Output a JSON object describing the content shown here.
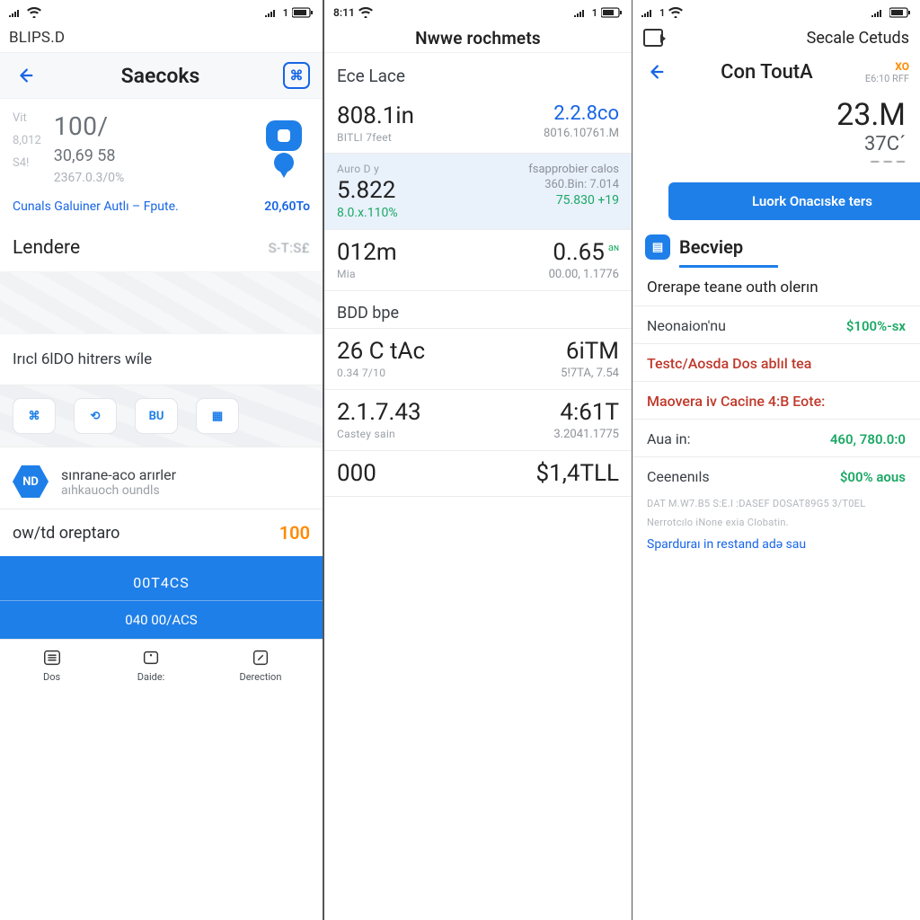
{
  "phone1": {
    "status": {
      "carrier": "BLIPS.D",
      "time": ""
    },
    "header": {
      "title": "Saecoks",
      "icon_glyph": "⌘"
    },
    "metrics": {
      "labels": [
        "Vit",
        "8,012",
        "S4!"
      ],
      "big": "100/",
      "mid": "30,69 58",
      "sm": "2367.0.3/0%"
    },
    "linkrow": {
      "left": "Cunals  Galuiner Autlı – Fpute.",
      "right": "20,60To"
    },
    "section": {
      "title": "Lendere",
      "right": "S-T:S£"
    },
    "rowtitle": "Irıcl 6lDO hitrers wíle",
    "chips": [
      "⌘",
      "⟲",
      "BU",
      "▦"
    ],
    "listcard": {
      "hex": "ND",
      "title": "sınrane-aco arırler",
      "subtitle": "aıhkauoch oundls"
    },
    "rowkv": {
      "k": "ow/td oreptaro",
      "v": "100"
    },
    "bluefoot": {
      "a": "00T4CS",
      "b": "040 00/ACS"
    },
    "tabs": [
      "Dos",
      "Daide:",
      "Derection"
    ]
  },
  "phone2": {
    "status_time": "8:11",
    "title": "Nwwe rochmets",
    "section": "Ece Lace",
    "rows": [
      {
        "la": "808.1in",
        "lb": "BITLI 7feet",
        "ra": "2.2.8co",
        "rb": "8016.10761.M",
        "raClass": "c"
      },
      {
        "hl": true,
        "la": "Auro D y",
        "lb": "",
        "la2": "5.822",
        "lc": "8.0.x.110%",
        "ra": "",
        "re": "fsapprobier calos",
        "rb": "360.Bin:   7.014",
        "rc": "75.830 +19"
      },
      {
        "la": "012m",
        "lb": "Mia",
        "ra": "0..65",
        "rb": "00.00, 1.1776",
        "riny": "aɴ"
      },
      {
        "sep": "BDD bpe"
      },
      {
        "la": "26 C  tAc",
        "lb": "0.34  7/10",
        "ra": "6iTM",
        "rb": "5!7TA,   7.54"
      },
      {
        "la": "2.1.7.43",
        "lb": "Castey sain",
        "ra": "4:61T",
        "rb": "3.2041.1775"
      },
      {
        "la": "000",
        "lb": "",
        "ra": "$1,4TLL",
        "rb": ""
      }
    ]
  },
  "phone3": {
    "brand": "Secale Cetuds",
    "header": {
      "title": "Con ToutA",
      "code": "XO",
      "code2": "E6:10 RFF"
    },
    "big": "23.M",
    "big2": "37C´",
    "cta": "Luork Onacıske ters",
    "tab": "Becviep",
    "subtitle": "Orerape teane outh olerın",
    "txns": [
      {
        "t": "Neonaion'nu",
        "amt": "$100%-sx",
        "cls": "green"
      },
      {
        "t": "Testc/Aosda Dos ablıl tea",
        "amt": "",
        "cls": "red"
      },
      {
        "t": "Maovera iv Cacine 4:B Eote:",
        "amt": "",
        "cls": "red"
      },
      {
        "t": "Aua in:",
        "amt": "460, 780.0:0",
        "cls": "green"
      },
      {
        "t": "Ceenenıls",
        "amt": "$00%  aous",
        "cls": "green"
      }
    ],
    "foot1": "DAT  M.W7.B5 S:E.I  :DASEF  DOSAT89G5  3/T0EL",
    "foot2": "Nerrotcılo iNone exia Clobatin.",
    "linklast": "Sparduraı in restand adə sau"
  }
}
